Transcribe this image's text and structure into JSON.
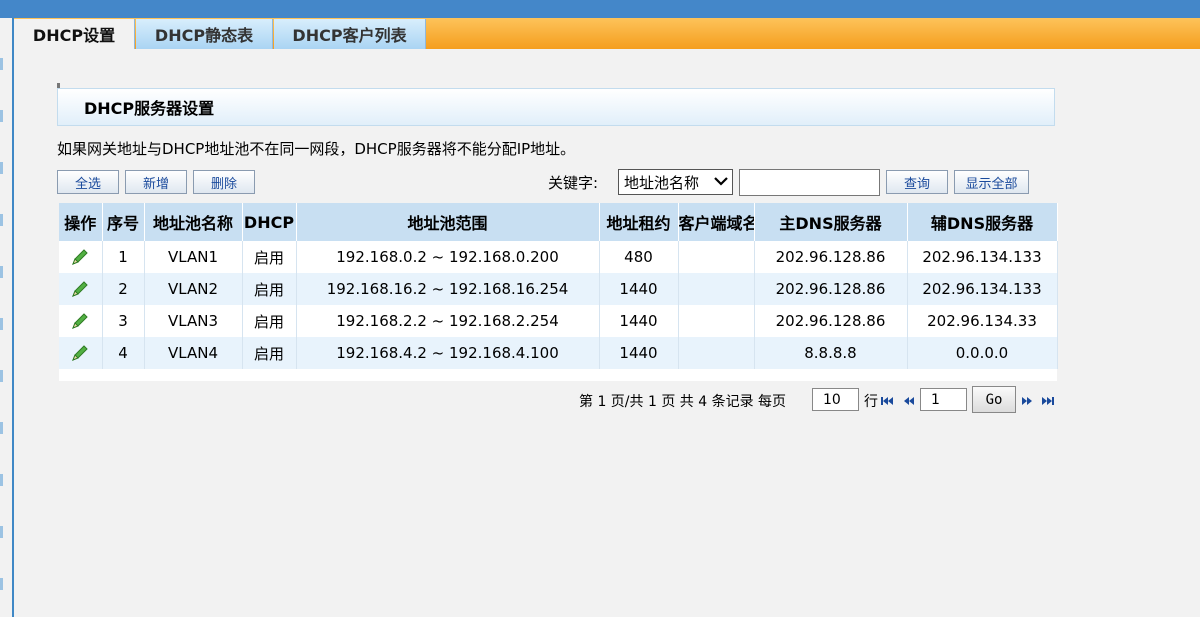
{
  "tabs": [
    {
      "label": "DHCP设置",
      "active": true
    },
    {
      "label": "DHCP静态表",
      "active": false
    },
    {
      "label": "DHCP客户列表",
      "active": false
    }
  ],
  "panel": {
    "title": "DHCP服务器设置"
  },
  "notice": "如果网关地址与DHCP地址池不在同一网段，DHCP服务器将不能分配IP地址。",
  "toolbar": {
    "select_all": "全选",
    "add": "新增",
    "delete": "删除"
  },
  "search": {
    "label": "关键字:",
    "select_value": "地址池名称",
    "query": "查询",
    "show_all": "显示全部"
  },
  "table": {
    "headers": [
      "操作",
      "序号",
      "地址池名称",
      "DHCP",
      "地址池范围",
      "地址租约",
      "客户端域名",
      "主DNS服务器",
      "辅DNS服务器"
    ],
    "rows": [
      {
        "index": "1",
        "name": "VLAN1",
        "dhcp": "启用",
        "range": "192.168.0.2 ~ 192.168.0.200",
        "lease": "480",
        "domain": "",
        "dns1": "202.96.128.86",
        "dns2": "202.96.134.133"
      },
      {
        "index": "2",
        "name": "VLAN2",
        "dhcp": "启用",
        "range": "192.168.16.2 ~ 192.168.16.254",
        "lease": "1440",
        "domain": "",
        "dns1": "202.96.128.86",
        "dns2": "202.96.134.133"
      },
      {
        "index": "3",
        "name": "VLAN3",
        "dhcp": "启用",
        "range": "192.168.2.2 ~ 192.168.2.254",
        "lease": "1440",
        "domain": "",
        "dns1": "202.96.128.86",
        "dns2": "202.96.134.33"
      },
      {
        "index": "4",
        "name": "VLAN4",
        "dhcp": "启用",
        "range": "192.168.4.2 ~ 192.168.4.100",
        "lease": "1440",
        "domain": "",
        "dns1": "8.8.8.8",
        "dns2": "0.0.0.0"
      }
    ]
  },
  "pager": {
    "summary": "第 1 页/共 1 页 共 4 条记录 每页",
    "page_size": "10",
    "row_label": "行",
    "page": "1",
    "go": "Go"
  },
  "colors": {
    "topbar": "#4487c9",
    "tabbar": "#f5a623",
    "header_bg": "#c8dff2",
    "row_alt": "#e8f3fc",
    "button_text": "#1a4a9c"
  },
  "icons": {
    "edit": "pencil-icon",
    "first": "first-page-icon",
    "prev": "prev-page-icon",
    "next": "next-page-icon",
    "last": "last-page-icon"
  }
}
